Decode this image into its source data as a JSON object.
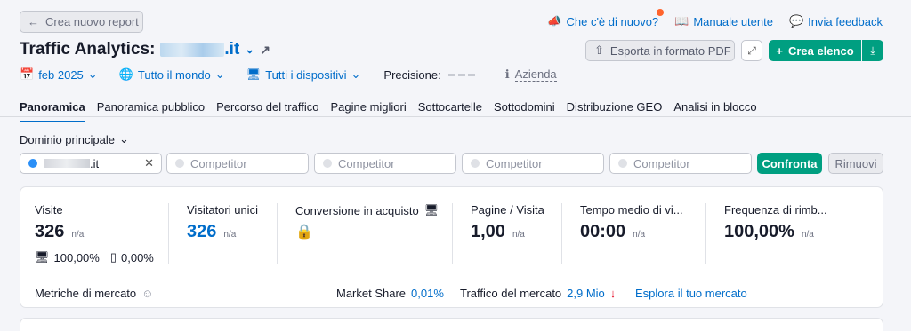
{
  "header": {
    "back_label": "Crea nuovo report",
    "links": {
      "whats_new": "Che c'è di nuovo?",
      "manual": "Manuale utente",
      "feedback": "Invia feedback"
    },
    "title_prefix": "Traffic Analytics:",
    "domain_tld": ".it",
    "export_label": "Esporta in formato PDF",
    "create_label": "Crea elenco"
  },
  "filters": {
    "date": "feb 2025",
    "region": "Tutto il mondo",
    "devices": "Tutti i dispositivi",
    "precision_label": "Precisione:",
    "company": "Azienda"
  },
  "tabs": [
    "Panoramica",
    "Panoramica pubblico",
    "Percorso del traffico",
    "Pagine migliori",
    "Sottocartelle",
    "Sottodomini",
    "Distribuzione GEO",
    "Analisi in blocco"
  ],
  "compare": {
    "domain_label": "Dominio principale",
    "main_tld": ".it",
    "competitor_placeholder": "Competitor",
    "compare_btn": "Confronta",
    "remove_btn": "Rimuovi"
  },
  "metrics": {
    "visits": {
      "label": "Visite",
      "value": "326",
      "na": "n/a",
      "desktop": "100,00%",
      "mobile": "0,00%"
    },
    "unique": {
      "label": "Visitatori unici",
      "value": "326",
      "na": "n/a"
    },
    "conversion": {
      "label": "Conversione in acquisto"
    },
    "pages": {
      "label": "Pagine / Visita",
      "value": "1,00",
      "na": "n/a"
    },
    "time": {
      "label": "Tempo medio di vi...",
      "value": "00:00",
      "na": "n/a"
    },
    "bounce": {
      "label": "Frequenza di rimb...",
      "value": "100,00%",
      "na": "n/a"
    }
  },
  "market": {
    "label": "Metriche di mercato",
    "share_label": "Market Share",
    "share_value": "0,01%",
    "traffic_label": "Traffico del mercato",
    "traffic_value": "2,9 Mio",
    "explore": "Esplora il tuo mercato"
  },
  "colors": {
    "accent": "#006dca",
    "green": "#009f81",
    "orange_dot": "#ff642d",
    "down_red": "#e4001b"
  }
}
